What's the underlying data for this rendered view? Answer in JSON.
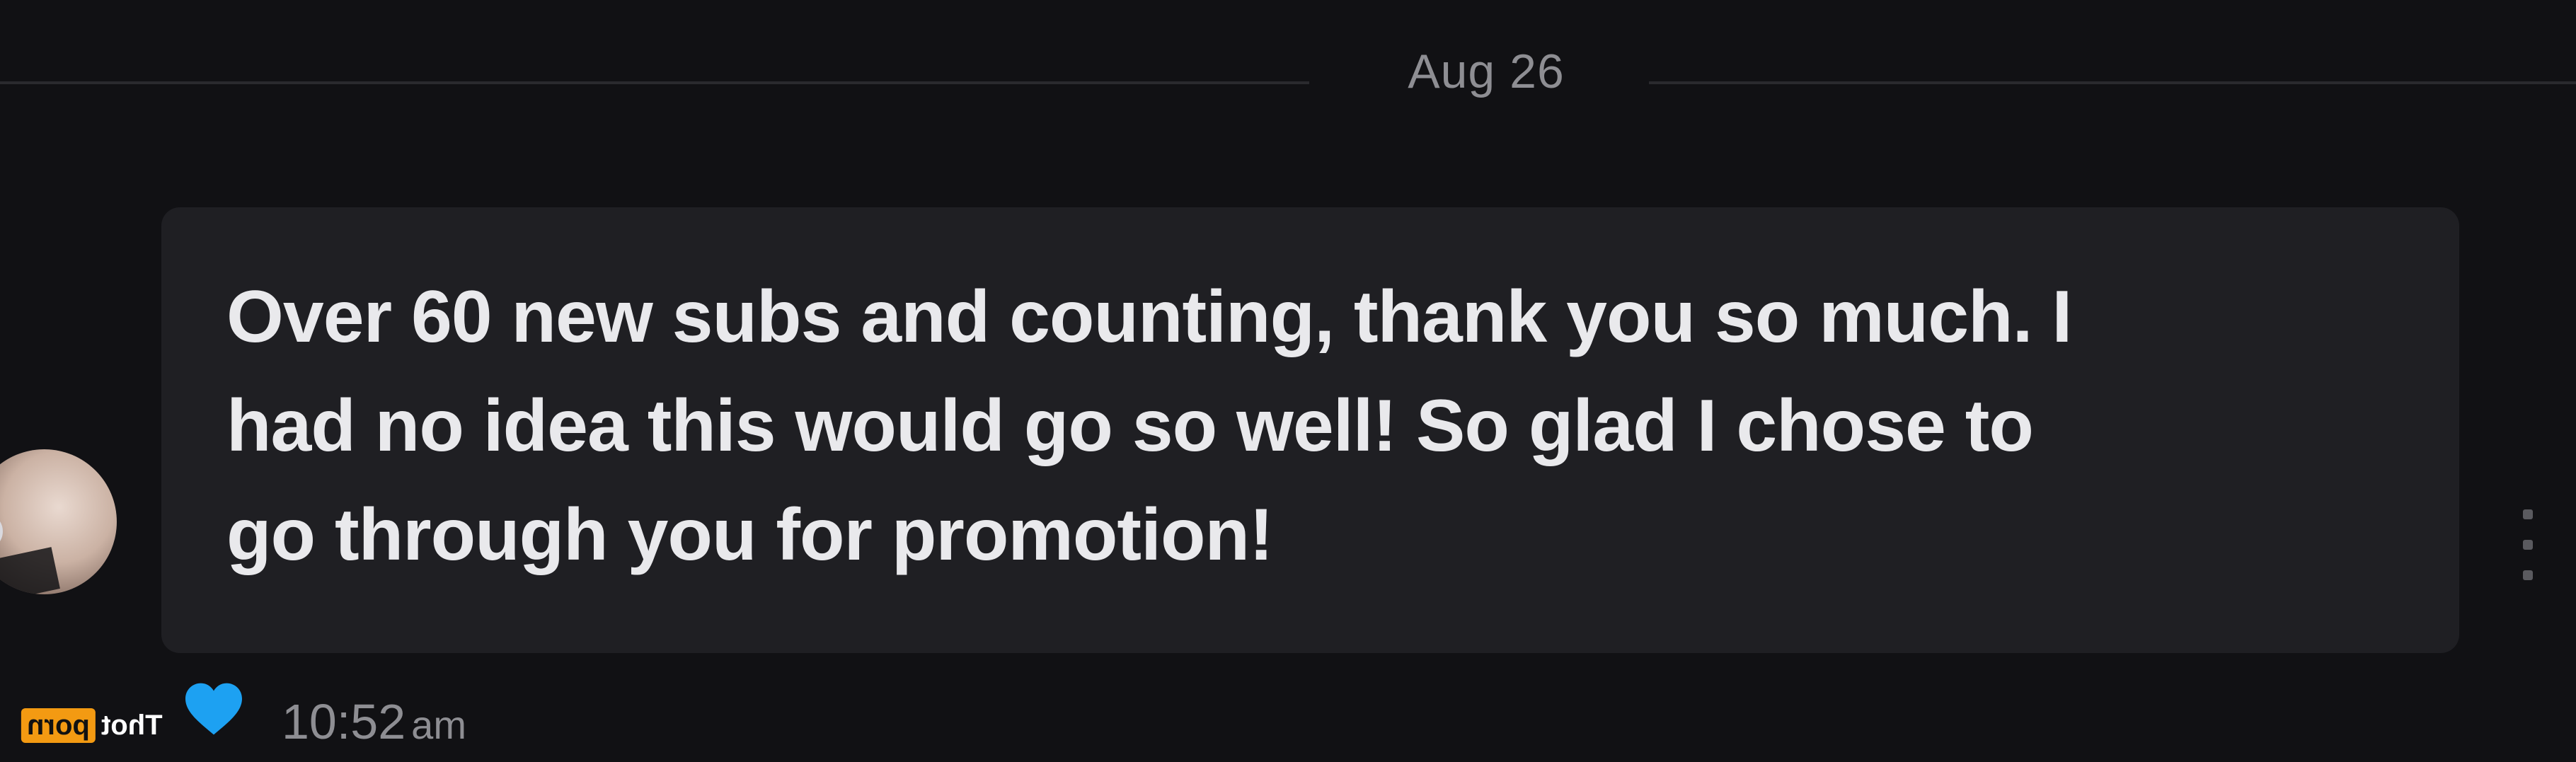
{
  "conversation": {
    "date_separator": "Aug 26"
  },
  "message": {
    "lines": [
      "Over 60 new subs and counting, thank you so much. I",
      "had no idea this would go so well! So glad I chose to",
      "go through you for promotion!"
    ],
    "time": "10:52",
    "time_suffix": "am",
    "reaction_icon": "heart-icon",
    "reaction_color": "#1da1f2"
  },
  "watermark": {
    "left_text": "porn",
    "right_text": "Thot",
    "color": "#f39a12"
  },
  "colors": {
    "background": "#111114",
    "bubble": "#1f1f23",
    "text": "#e9e9ec",
    "muted": "#8e8e93"
  }
}
